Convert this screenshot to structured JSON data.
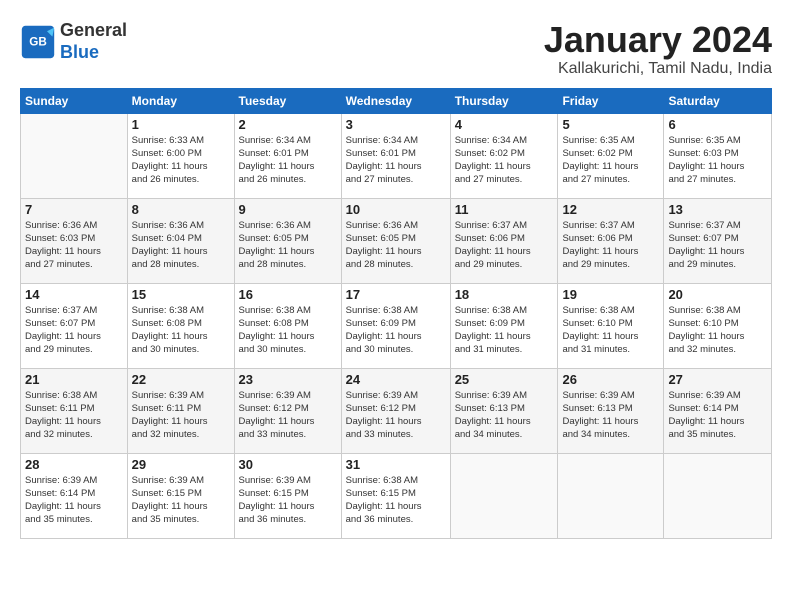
{
  "header": {
    "logo_line1": "General",
    "logo_line2": "Blue",
    "month_title": "January 2024",
    "subtitle": "Kallakurichi, Tamil Nadu, India"
  },
  "weekdays": [
    "Sunday",
    "Monday",
    "Tuesday",
    "Wednesday",
    "Thursday",
    "Friday",
    "Saturday"
  ],
  "weeks": [
    {
      "shaded": false,
      "days": [
        {
          "num": "",
          "info": ""
        },
        {
          "num": "1",
          "info": "Sunrise: 6:33 AM\nSunset: 6:00 PM\nDaylight: 11 hours\nand 26 minutes."
        },
        {
          "num": "2",
          "info": "Sunrise: 6:34 AM\nSunset: 6:01 PM\nDaylight: 11 hours\nand 26 minutes."
        },
        {
          "num": "3",
          "info": "Sunrise: 6:34 AM\nSunset: 6:01 PM\nDaylight: 11 hours\nand 27 minutes."
        },
        {
          "num": "4",
          "info": "Sunrise: 6:34 AM\nSunset: 6:02 PM\nDaylight: 11 hours\nand 27 minutes."
        },
        {
          "num": "5",
          "info": "Sunrise: 6:35 AM\nSunset: 6:02 PM\nDaylight: 11 hours\nand 27 minutes."
        },
        {
          "num": "6",
          "info": "Sunrise: 6:35 AM\nSunset: 6:03 PM\nDaylight: 11 hours\nand 27 minutes."
        }
      ]
    },
    {
      "shaded": true,
      "days": [
        {
          "num": "7",
          "info": "Sunrise: 6:36 AM\nSunset: 6:03 PM\nDaylight: 11 hours\nand 27 minutes."
        },
        {
          "num": "8",
          "info": "Sunrise: 6:36 AM\nSunset: 6:04 PM\nDaylight: 11 hours\nand 28 minutes."
        },
        {
          "num": "9",
          "info": "Sunrise: 6:36 AM\nSunset: 6:05 PM\nDaylight: 11 hours\nand 28 minutes."
        },
        {
          "num": "10",
          "info": "Sunrise: 6:36 AM\nSunset: 6:05 PM\nDaylight: 11 hours\nand 28 minutes."
        },
        {
          "num": "11",
          "info": "Sunrise: 6:37 AM\nSunset: 6:06 PM\nDaylight: 11 hours\nand 29 minutes."
        },
        {
          "num": "12",
          "info": "Sunrise: 6:37 AM\nSunset: 6:06 PM\nDaylight: 11 hours\nand 29 minutes."
        },
        {
          "num": "13",
          "info": "Sunrise: 6:37 AM\nSunset: 6:07 PM\nDaylight: 11 hours\nand 29 minutes."
        }
      ]
    },
    {
      "shaded": false,
      "days": [
        {
          "num": "14",
          "info": "Sunrise: 6:37 AM\nSunset: 6:07 PM\nDaylight: 11 hours\nand 29 minutes."
        },
        {
          "num": "15",
          "info": "Sunrise: 6:38 AM\nSunset: 6:08 PM\nDaylight: 11 hours\nand 30 minutes."
        },
        {
          "num": "16",
          "info": "Sunrise: 6:38 AM\nSunset: 6:08 PM\nDaylight: 11 hours\nand 30 minutes."
        },
        {
          "num": "17",
          "info": "Sunrise: 6:38 AM\nSunset: 6:09 PM\nDaylight: 11 hours\nand 30 minutes."
        },
        {
          "num": "18",
          "info": "Sunrise: 6:38 AM\nSunset: 6:09 PM\nDaylight: 11 hours\nand 31 minutes."
        },
        {
          "num": "19",
          "info": "Sunrise: 6:38 AM\nSunset: 6:10 PM\nDaylight: 11 hours\nand 31 minutes."
        },
        {
          "num": "20",
          "info": "Sunrise: 6:38 AM\nSunset: 6:10 PM\nDaylight: 11 hours\nand 32 minutes."
        }
      ]
    },
    {
      "shaded": true,
      "days": [
        {
          "num": "21",
          "info": "Sunrise: 6:38 AM\nSunset: 6:11 PM\nDaylight: 11 hours\nand 32 minutes."
        },
        {
          "num": "22",
          "info": "Sunrise: 6:39 AM\nSunset: 6:11 PM\nDaylight: 11 hours\nand 32 minutes."
        },
        {
          "num": "23",
          "info": "Sunrise: 6:39 AM\nSunset: 6:12 PM\nDaylight: 11 hours\nand 33 minutes."
        },
        {
          "num": "24",
          "info": "Sunrise: 6:39 AM\nSunset: 6:12 PM\nDaylight: 11 hours\nand 33 minutes."
        },
        {
          "num": "25",
          "info": "Sunrise: 6:39 AM\nSunset: 6:13 PM\nDaylight: 11 hours\nand 34 minutes."
        },
        {
          "num": "26",
          "info": "Sunrise: 6:39 AM\nSunset: 6:13 PM\nDaylight: 11 hours\nand 34 minutes."
        },
        {
          "num": "27",
          "info": "Sunrise: 6:39 AM\nSunset: 6:14 PM\nDaylight: 11 hours\nand 35 minutes."
        }
      ]
    },
    {
      "shaded": false,
      "days": [
        {
          "num": "28",
          "info": "Sunrise: 6:39 AM\nSunset: 6:14 PM\nDaylight: 11 hours\nand 35 minutes."
        },
        {
          "num": "29",
          "info": "Sunrise: 6:39 AM\nSunset: 6:15 PM\nDaylight: 11 hours\nand 35 minutes."
        },
        {
          "num": "30",
          "info": "Sunrise: 6:39 AM\nSunset: 6:15 PM\nDaylight: 11 hours\nand 36 minutes."
        },
        {
          "num": "31",
          "info": "Sunrise: 6:38 AM\nSunset: 6:15 PM\nDaylight: 11 hours\nand 36 minutes."
        },
        {
          "num": "",
          "info": ""
        },
        {
          "num": "",
          "info": ""
        },
        {
          "num": "",
          "info": ""
        }
      ]
    }
  ]
}
